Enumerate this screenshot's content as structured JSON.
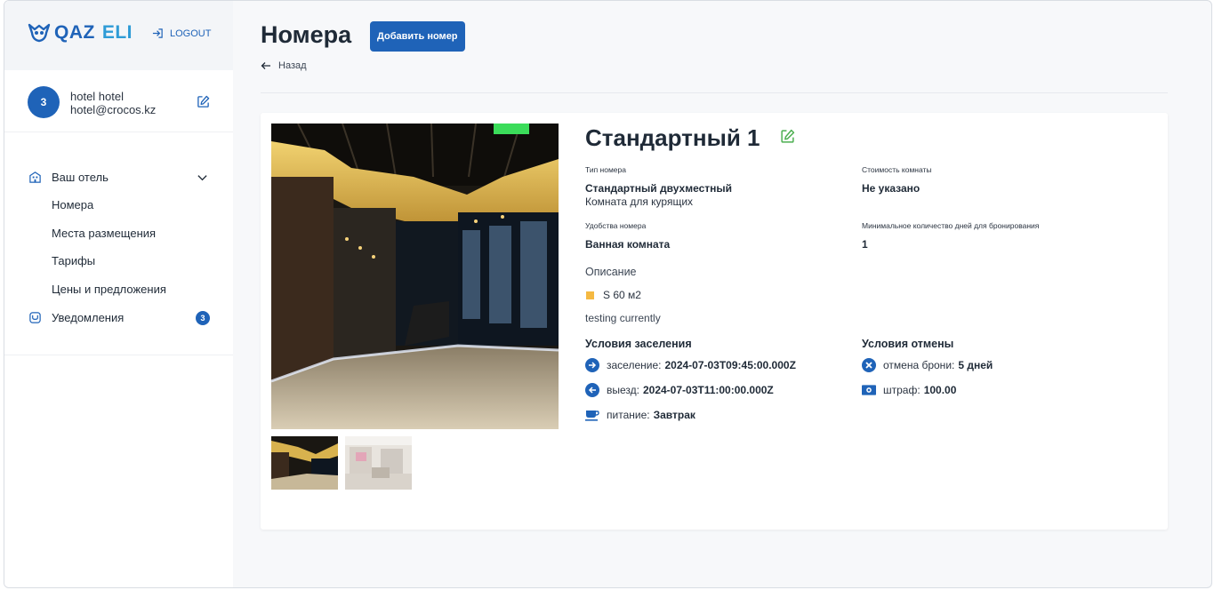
{
  "app": {
    "logo_q": "QAZ",
    "logo_eli": "ELI",
    "logout_label": "LOGOUT"
  },
  "profile": {
    "avatar": "3",
    "name": "hotel hotel",
    "email": "hotel@crocos.kz"
  },
  "sidebar": {
    "your_hotel": "Ваш отель",
    "items": [
      {
        "label": "Номера"
      },
      {
        "label": "Места размещения"
      },
      {
        "label": "Тарифы"
      },
      {
        "label": "Цены и предложения"
      }
    ],
    "notifications": "Уведомления",
    "notifications_count": "3"
  },
  "header": {
    "title": "Номера",
    "add_button": "Добавить номер",
    "back": "Назад"
  },
  "room": {
    "title": "Стандартный 1",
    "type_label": "Тип номера",
    "type_value": "Стандартный двухместный",
    "type_sub": "Комната для курящих",
    "price_label": "Стоимость комнаты",
    "price_value": "Не указано",
    "amenities_label": "Удобства номера",
    "amenities_value": "Ванная комната",
    "min_days_label": "Минимальное количество дней для бронирования",
    "min_days_value": "1",
    "description_label": "Описание",
    "area": "S 60 м2",
    "description": "testing currently",
    "checkin_heading": "Условия заселения",
    "checkin_label": "заселение:",
    "checkin_value": "2024-07-03T09:45:00.000Z",
    "checkout_label": "выезд:",
    "checkout_value": "2024-07-03T11:00:00.000Z",
    "meal_label": "питание:",
    "meal_value": "Завтрак",
    "cancel_heading": "Условия отмены",
    "cancel_label": "отмена брони:",
    "cancel_value": "5 дней",
    "fine_label": "штраф:",
    "fine_value": "100.00"
  },
  "colors": {
    "accent": "#1f63b8",
    "edit_green": "#4caf50",
    "area_square": "#f5b942"
  }
}
